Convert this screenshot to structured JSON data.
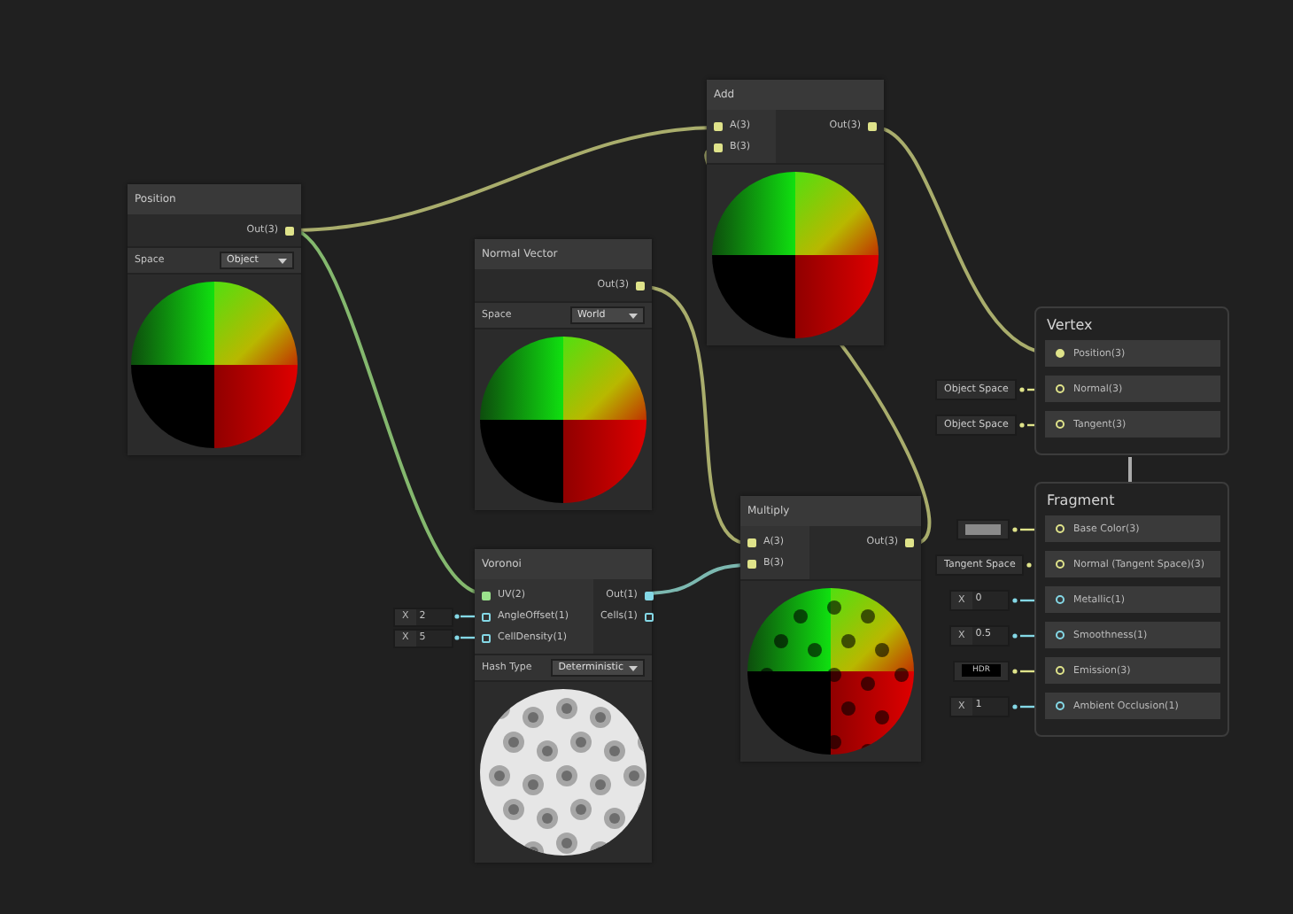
{
  "nodes": [
    {
      "title": "Position",
      "outputs": [
        {
          "label": "Out(3)",
          "kind": "vector3",
          "connected": true
        }
      ],
      "fields": [
        {
          "label": "Space",
          "value": "Object"
        }
      ],
      "preview": {
        "kind": "sphere"
      }
    },
    {
      "title": "Normal Vector",
      "outputs": [
        {
          "label": "Out(3)",
          "kind": "vector3",
          "connected": true
        }
      ],
      "fields": [
        {
          "label": "Space",
          "value": "World"
        }
      ],
      "preview": {
        "kind": "sphere"
      }
    },
    {
      "title": "Add",
      "inputs": [
        {
          "label": "A(3)",
          "kind": "vector3",
          "connected": true
        },
        {
          "label": "B(3)",
          "kind": "vector3",
          "connected": true
        }
      ],
      "outputs": [
        {
          "label": "Out(3)",
          "kind": "vector3",
          "connected": true
        }
      ],
      "preview": {
        "kind": "sphere"
      }
    },
    {
      "title": "Multiply",
      "inputs": [
        {
          "label": "A(3)",
          "kind": "vector3",
          "connected": true
        },
        {
          "label": "B(3)",
          "kind": "vector3",
          "connected": true
        }
      ],
      "outputs": [
        {
          "label": "Out(3)",
          "kind": "vector3",
          "connected": true
        }
      ],
      "preview": {
        "kind": "spotted"
      }
    },
    {
      "title": "Voronoi",
      "inputs": [
        {
          "label": "UV(2)",
          "kind": "vector2",
          "connected": true
        },
        {
          "label": "AngleOffset(1)",
          "kind": "vector1",
          "connected": false,
          "inline": {
            "axis": "X",
            "value": "2"
          }
        },
        {
          "label": "CellDensity(1)",
          "kind": "vector1",
          "connected": false,
          "inline": {
            "axis": "X",
            "value": "5"
          }
        }
      ],
      "outputs": [
        {
          "label": "Out(1)",
          "kind": "vector1",
          "connected": true
        },
        {
          "label": "Cells(1)",
          "kind": "vector1",
          "connected": false
        }
      ],
      "fields": [
        {
          "label": "Hash Type",
          "value": "Deterministic"
        }
      ],
      "preview": {
        "kind": "voronoi"
      }
    }
  ],
  "master": [
    {
      "title": "Vertex",
      "slots": [
        {
          "label": "Position(3)",
          "kind": "vector3",
          "connected": true
        },
        {
          "label": "Normal(3)",
          "kind": "vector3",
          "connected": false,
          "default": {
            "kind": "text",
            "value": "Object Space"
          }
        },
        {
          "label": "Tangent(3)",
          "kind": "vector3",
          "connected": false,
          "default": {
            "kind": "text",
            "value": "Object Space"
          }
        }
      ]
    },
    {
      "title": "Fragment",
      "slots": [
        {
          "label": "Base Color(3)",
          "kind": "vector3",
          "connected": false,
          "default": {
            "kind": "swatch"
          }
        },
        {
          "label": "Normal (Tangent Space)(3)",
          "kind": "vector3",
          "connected": false,
          "default": {
            "kind": "text",
            "value": "Tangent Space"
          }
        },
        {
          "label": "Metallic(1)",
          "kind": "vector1",
          "connected": false,
          "default": {
            "kind": "number",
            "axis": "X",
            "value": "0"
          }
        },
        {
          "label": "Smoothness(1)",
          "kind": "vector1",
          "connected": false,
          "default": {
            "kind": "number",
            "axis": "X",
            "value": "0.5"
          }
        },
        {
          "label": "Emission(3)",
          "kind": "vector3",
          "connected": false,
          "default": {
            "kind": "hdr",
            "value": "HDR"
          }
        },
        {
          "label": "Ambient Occlusion(1)",
          "kind": "vector1",
          "connected": false,
          "default": {
            "kind": "number",
            "axis": "X",
            "value": "1"
          }
        }
      ]
    }
  ]
}
